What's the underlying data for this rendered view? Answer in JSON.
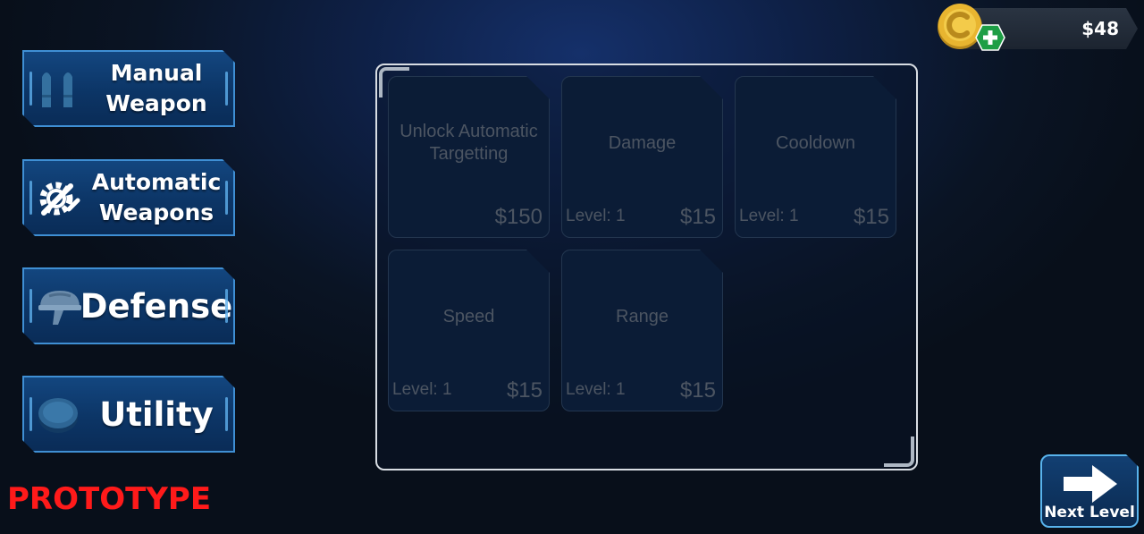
{
  "currency": {
    "amount": "$48",
    "icon": "coin-icon",
    "add_icon": "plus-icon"
  },
  "categories": [
    {
      "label": "Manual\nWeapon",
      "icon": "bullets-icon"
    },
    {
      "label": "Automatic\nWeapons",
      "icon": "gears-icon"
    },
    {
      "label": "Defense",
      "icon": "helmet-icon"
    },
    {
      "label": "Utility",
      "icon": "disc-icon"
    }
  ],
  "upgrades": [
    {
      "name": "Unlock Automatic Targetting",
      "level": "",
      "price": "$150"
    },
    {
      "name": "Damage",
      "level": "Level: 1",
      "price": "$15"
    },
    {
      "name": "Cooldown",
      "level": "Level: 1",
      "price": "$15"
    },
    {
      "name": "Speed",
      "level": "Level: 1",
      "price": "$15"
    },
    {
      "name": "Range",
      "level": "Level: 1",
      "price": "$15"
    }
  ],
  "prototype_label": "PROTOTYPE",
  "next_level": {
    "label": "Next Level",
    "icon": "arrow-right-icon"
  },
  "colors": {
    "prototype": "#ff1a1a",
    "button_border": "#3f8fd4",
    "tile_text": "#4c5562",
    "plus_badge": "#2ecc5a",
    "coin": "#e8b530"
  }
}
